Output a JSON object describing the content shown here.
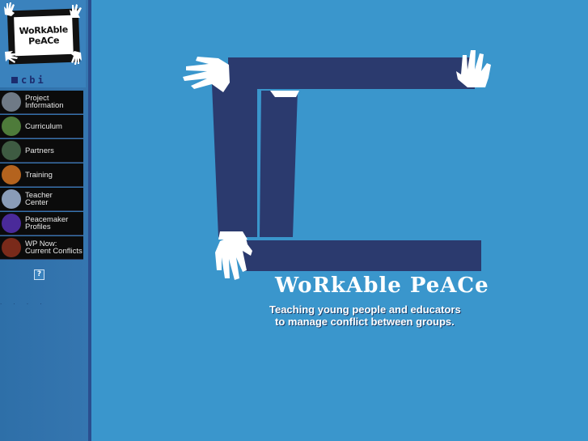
{
  "logo": {
    "line1": "WoRkAble",
    "line2": "PeACe",
    "org": "cbi"
  },
  "nav": [
    {
      "label": "Project\nInformation",
      "icon": "projector-icon",
      "color": "#6f7a86"
    },
    {
      "label": "Curriculum",
      "icon": "book-icon",
      "color": "#4e7b3a"
    },
    {
      "label": "Partners",
      "icon": "globe-icon",
      "color": "#3e5b42"
    },
    {
      "label": "Training",
      "icon": "puzzle-icon",
      "color": "#b4631e"
    },
    {
      "label": "Teacher\nCenter",
      "icon": "handshake-icon",
      "color": "#8a9cb8"
    },
    {
      "label": "Peacemaker\nProfiles",
      "icon": "face-icon",
      "color": "#4a2a9a"
    },
    {
      "label": "WP Now:\nCurrent Conflicts",
      "icon": "barbed-wire-icon",
      "color": "#7a2a1a"
    }
  ],
  "help_label": "?",
  "dots": ". . . .",
  "hero": {
    "title_main": "WoRkAble PeACe",
    "tagline_1": "Teaching young people and educators",
    "tagline_2": "to manage conflict between groups."
  },
  "colors": {
    "background": "#3a96cc",
    "arm": "#2b3a6e",
    "sidebar": "#3576b0"
  }
}
